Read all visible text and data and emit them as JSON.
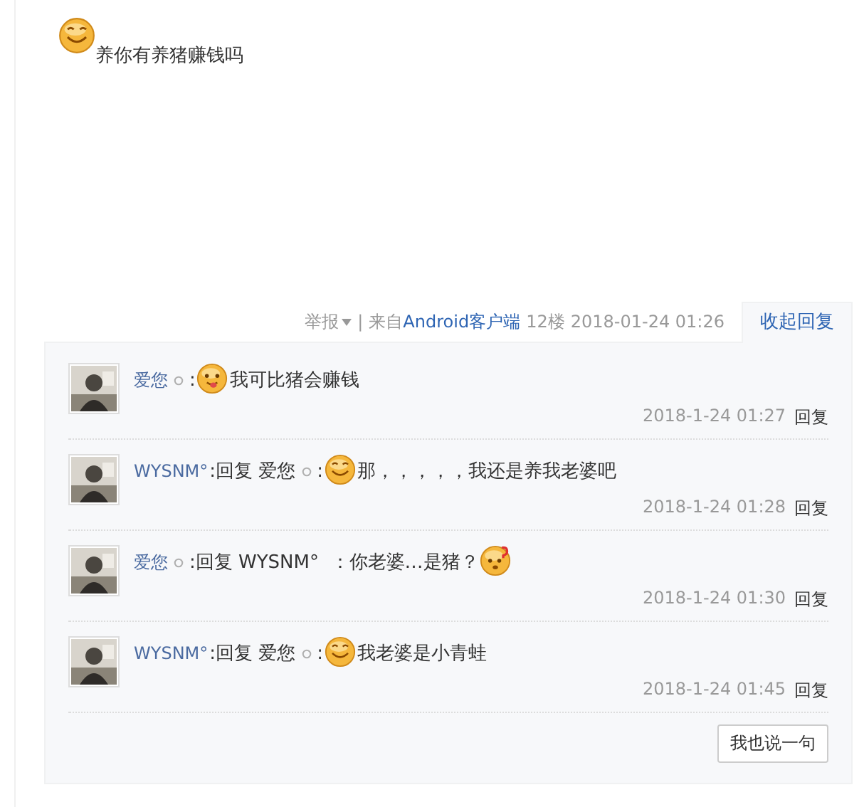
{
  "post": {
    "content": [
      {
        "kind": "smile"
      },
      {
        "kind": "text",
        "text": "养你有养猪赚钱吗"
      }
    ]
  },
  "meta": {
    "report": "举报",
    "separator": "|",
    "source_prefix": "来自",
    "source_link": "Android客户端",
    "floor": "12楼",
    "time": "2018-01-24 01:26",
    "toggle": "收起回复"
  },
  "replies": [
    {
      "parts": [
        {
          "kind": "name",
          "text": "爱您"
        },
        {
          "kind": "badge"
        },
        {
          "kind": "text",
          "text": ":"
        },
        {
          "kind": "tongue"
        },
        {
          "kind": "text",
          "text": "我可比猪会赚钱"
        }
      ],
      "time": "2018-1-24 01:27",
      "reply": "回复"
    },
    {
      "parts": [
        {
          "kind": "name",
          "text": "WYSNM°"
        },
        {
          "kind": "text",
          "text": ":回复 爱您"
        },
        {
          "kind": "badge"
        },
        {
          "kind": "text",
          "text": ":"
        },
        {
          "kind": "smile"
        },
        {
          "kind": "text",
          "text": "那，，，，，我还是养我老婆吧"
        }
      ],
      "time": "2018-1-24 01:28",
      "reply": "回复"
    },
    {
      "parts": [
        {
          "kind": "name",
          "text": "爱您"
        },
        {
          "kind": "badge"
        },
        {
          "kind": "text",
          "text": ":回复 WYSNM°  ：你老婆…是猪？"
        },
        {
          "kind": "question"
        }
      ],
      "time": "2018-1-24 01:30",
      "reply": "回复"
    },
    {
      "parts": [
        {
          "kind": "name",
          "text": "WYSNM°"
        },
        {
          "kind": "text",
          "text": ":回复 爱您"
        },
        {
          "kind": "badge"
        },
        {
          "kind": "text",
          "text": ":"
        },
        {
          "kind": "smile"
        },
        {
          "kind": "text",
          "text": "我老婆是小青蛙"
        }
      ],
      "time": "2018-1-24 01:45",
      "reply": "回复"
    }
  ],
  "say_button": "我也说一句"
}
